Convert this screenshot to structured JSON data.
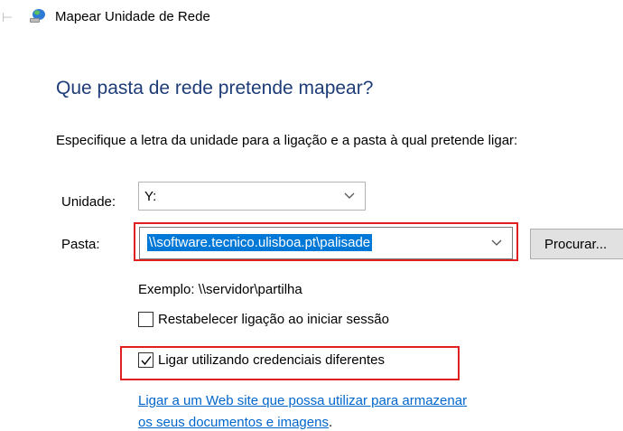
{
  "header": {
    "back_icon": "back-arrow-icon",
    "app_icon": "network-drive-icon",
    "title": "Mapear Unidade de Rede"
  },
  "main": {
    "heading": "Que pasta de rede pretende mapear?",
    "instructions": "Especifique a letra da unidade para a ligação e a pasta à qual pretende ligar:",
    "drive": {
      "label": "Unidade:",
      "value": "Y:"
    },
    "folder": {
      "label": "Pasta:",
      "value": "\\\\software.tecnico.ulisboa.pt\\palisade"
    },
    "browse_label": "Procurar...",
    "example": "Exemplo: \\\\servidor\\partilha",
    "reconnect": {
      "label": "Restabelecer ligação ao iniciar sessão",
      "checked": false
    },
    "credentials": {
      "label": "Ligar utilizando credenciais diferentes",
      "checked": true
    },
    "web_link": {
      "line1": "Ligar a um Web site que possa utilizar para armazenar",
      "line2": "os seus documentos e imagens",
      "period": "."
    }
  },
  "colors": {
    "heading": "#1e3c78",
    "link": "#0066cc",
    "selection": "#0078d7",
    "highlight_box": "#e02020"
  }
}
